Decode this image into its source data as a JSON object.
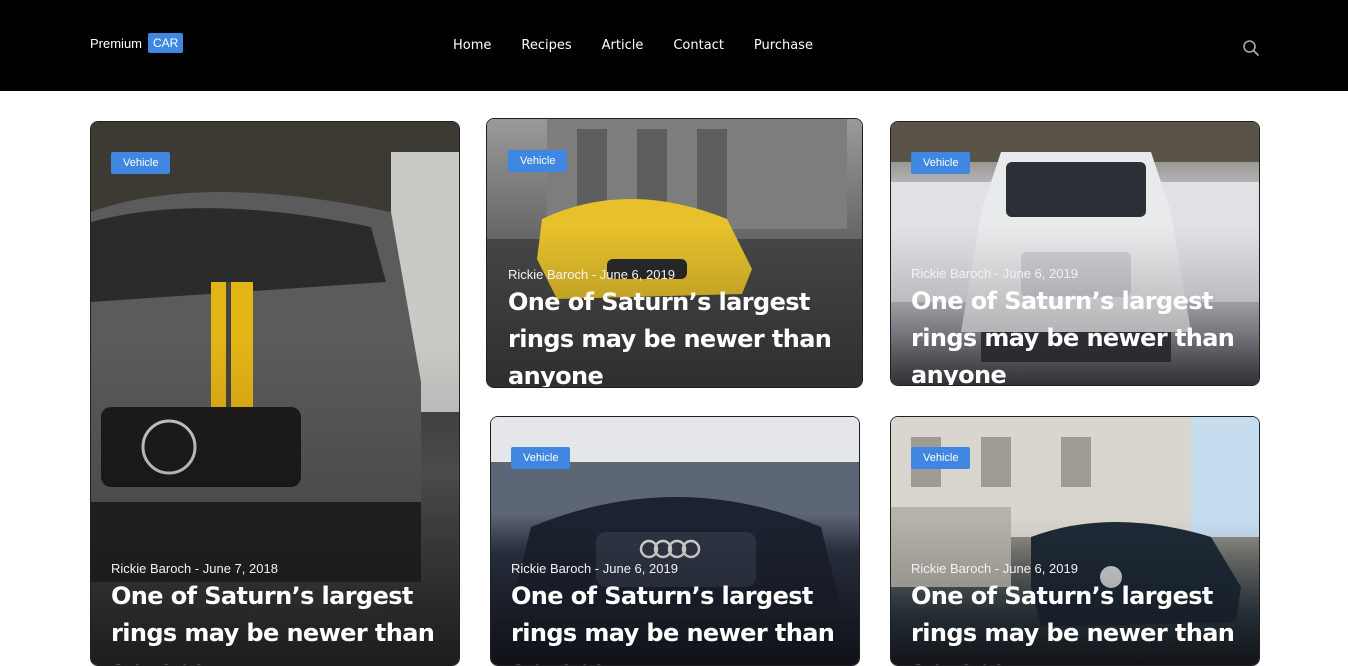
{
  "header": {
    "brand": {
      "text": "Premium",
      "badge": "CAR"
    },
    "nav": [
      {
        "label": "Home"
      },
      {
        "label": "Recipes"
      },
      {
        "label": "Article"
      },
      {
        "label": "Contact"
      },
      {
        "label": "Purchase"
      }
    ],
    "search_icon": "search-icon"
  },
  "cards": [
    {
      "category": "Vehicle",
      "meta": "Rickie Baroch - June 7, 2018",
      "title": "One of Saturn’s largest rings may be newer than anyone"
    },
    {
      "category": "Vehicle",
      "meta": "Rickie Baroch - June 6, 2019",
      "title": "One of Saturn’s largest rings may be newer than anyone"
    },
    {
      "category": "Vehicle",
      "meta": "Rickie Baroch - June 6, 2019",
      "title": "One of Saturn’s largest rings may be newer than anyone"
    },
    {
      "category": "Vehicle",
      "meta": "Rickie Baroch - June 6, 2019",
      "title": "One of Saturn’s largest rings may be newer than anyone"
    },
    {
      "category": "Vehicle",
      "meta": "Rickie Baroch - June 6, 2019",
      "title": "One of Saturn’s largest rings may be newer than anyone"
    }
  ],
  "colors": {
    "accent": "#3f87e0",
    "header_bg": "#000000"
  }
}
